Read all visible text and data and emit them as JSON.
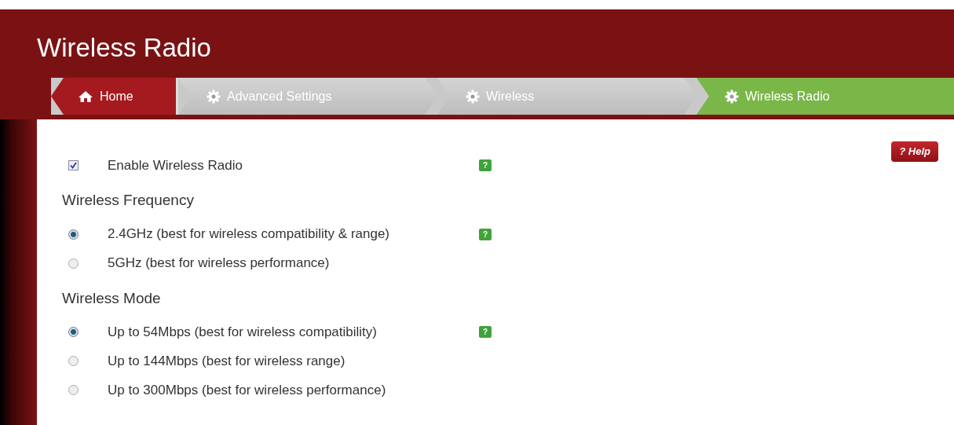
{
  "page_title": "Wireless Radio",
  "breadcrumb": [
    {
      "label": "Home",
      "kind": "home",
      "selected": false
    },
    {
      "label": "Advanced Settings",
      "kind": "gear",
      "selected": false
    },
    {
      "label": "Wireless",
      "kind": "gear",
      "selected": false
    },
    {
      "label": "Wireless Radio",
      "kind": "gear",
      "selected": true
    }
  ],
  "help_button": "? Help",
  "enable": {
    "label": "Enable Wireless Radio",
    "checked": true,
    "help": "?"
  },
  "sections": [
    {
      "heading": "Wireless Frequency",
      "options": [
        {
          "label": "2.4GHz (best for wireless compatibility & range)",
          "selected": true,
          "help": "?"
        },
        {
          "label": "5GHz (best for wireless performance)",
          "selected": false
        }
      ]
    },
    {
      "heading": "Wireless Mode",
      "options": [
        {
          "label": "Up to 54Mbps (best for wireless compatibility)",
          "selected": true,
          "help": "?"
        },
        {
          "label": "Up to 144Mbps (best for wireless range)",
          "selected": false
        },
        {
          "label": "Up to 300Mbps (best for wireless performance)",
          "selected": false
        }
      ]
    }
  ]
}
